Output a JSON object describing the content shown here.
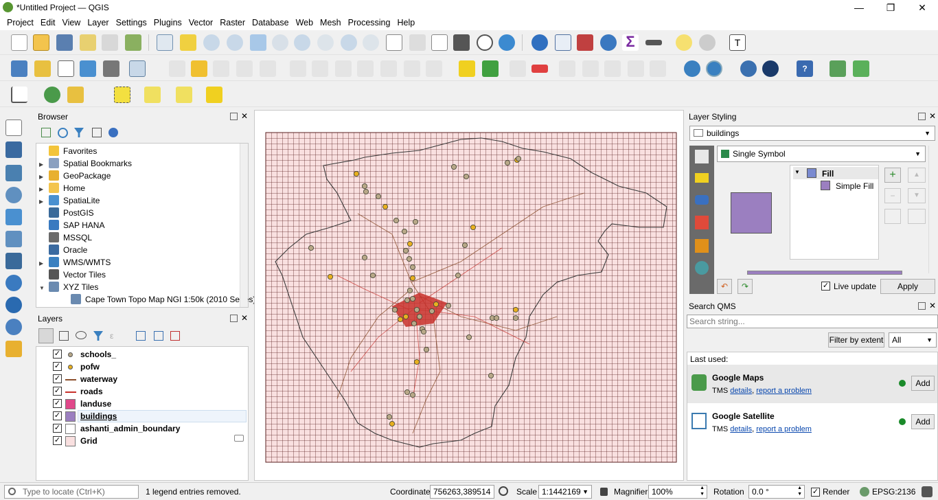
{
  "window": {
    "title": "*Untitled Project — QGIS",
    "minimize": "—",
    "maximize": "❐",
    "close": "✕"
  },
  "menu": [
    "Project",
    "Edit",
    "View",
    "Layer",
    "Settings",
    "Plugins",
    "Vector",
    "Raster",
    "Database",
    "Web",
    "Mesh",
    "Processing",
    "Help"
  ],
  "colors": {
    "accent": "#589632",
    "buildings": "#9b7fc0",
    "landuse": "#e0488a",
    "grid": "#f9e0e0",
    "roads": "#c8302a",
    "waterway": "#8b4d2a",
    "pofw": "#e8b020",
    "schools": "#b8a888"
  },
  "browser": {
    "title": "Browser",
    "items": [
      {
        "label": "Favorites",
        "icon": "star-icon",
        "arrow": ""
      },
      {
        "label": "Spatial Bookmarks",
        "icon": "bookmark-icon",
        "arrow": "▶"
      },
      {
        "label": "GeoPackage",
        "icon": "geopackage-icon",
        "arrow": "▶"
      },
      {
        "label": "Home",
        "icon": "folder-icon",
        "arrow": "▶"
      },
      {
        "label": "SpatiaLite",
        "icon": "spatialite-icon",
        "arrow": "▶"
      },
      {
        "label": "PostGIS",
        "icon": "postgis-icon",
        "arrow": ""
      },
      {
        "label": "SAP HANA",
        "icon": "saphana-icon",
        "arrow": ""
      },
      {
        "label": "MSSQL",
        "icon": "mssql-icon",
        "arrow": ""
      },
      {
        "label": "Oracle",
        "icon": "oracle-icon",
        "arrow": ""
      },
      {
        "label": "WMS/WMTS",
        "icon": "wms-icon",
        "arrow": "▶"
      },
      {
        "label": "Vector Tiles",
        "icon": "vectortiles-icon",
        "arrow": ""
      },
      {
        "label": "XYZ Tiles",
        "icon": "xyz-icon",
        "arrow": "▼"
      },
      {
        "label": "Cape Town Topo Map NGI 1:50k (2010 Series)",
        "icon": "xyz-icon",
        "arrow": ""
      }
    ]
  },
  "layers": {
    "title": "Layers",
    "items": [
      {
        "label": "schools_",
        "sym": "dot",
        "color": "#b8a888",
        "checked": "✓"
      },
      {
        "label": "pofw",
        "sym": "dot",
        "color": "#e8b020",
        "checked": "✓"
      },
      {
        "label": "waterway",
        "sym": "line",
        "color": "#8b4d2a",
        "checked": "✓"
      },
      {
        "label": "roads",
        "sym": "line",
        "color": "#c8302a",
        "checked": "✓"
      },
      {
        "label": "landuse",
        "sym": "fill",
        "color": "#e0488a",
        "checked": "✓"
      },
      {
        "label": "buildings",
        "sym": "fill",
        "color": "#9b7fc0",
        "checked": "✓"
      },
      {
        "label": "ashanti_admin_boundary",
        "sym": "fill",
        "color": "#ffffff",
        "checked": "✓"
      },
      {
        "label": "Grid",
        "sym": "fill",
        "color": "#f9e0e0",
        "checked": "✓"
      }
    ]
  },
  "styling": {
    "title": "Layer Styling",
    "layer": "buildings",
    "renderer": "Single Symbol",
    "fill": "Fill",
    "simple_fill": "Simple Fill",
    "live_update": "Live update",
    "apply": "Apply"
  },
  "qms": {
    "title": "Search QMS",
    "placeholder": "Search string...",
    "filter": "Filter by extent",
    "all": "All",
    "last_used": "Last used:",
    "services": [
      {
        "name": "Google Maps",
        "type": "TMS",
        "details": "details",
        "report": "report a problem",
        "add": "Add"
      },
      {
        "name": "Google Satellite",
        "type": "TMS",
        "details": "details",
        "report": "report a problem",
        "add": "Add"
      }
    ]
  },
  "status": {
    "locate_placeholder": "Type to locate (Ctrl+K)",
    "message": "1 legend entries removed.",
    "coordinate_label": "Coordinate",
    "coordinate": "756263,389514",
    "scale_label": "Scale",
    "scale": "1:1442169",
    "magnifier_label": "Magnifier",
    "magnifier": "100%",
    "rotation_label": "Rotation",
    "rotation": "0.0 °",
    "render": "Render",
    "crs": "EPSG:2136"
  }
}
